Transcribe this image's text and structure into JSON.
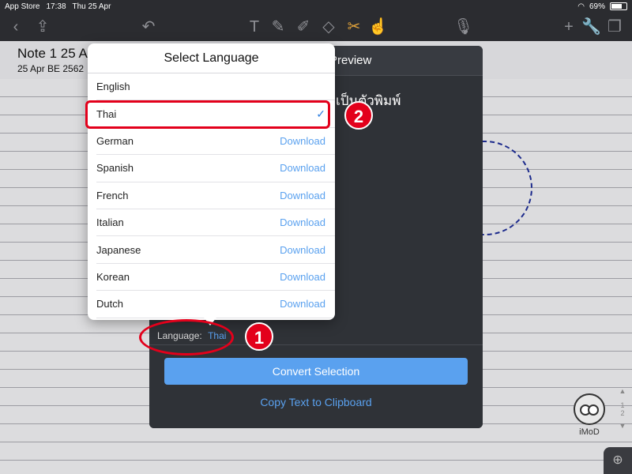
{
  "status_bar": {
    "back_app": "App Store",
    "time": "17:38",
    "date": "Thu 25 Apr",
    "battery": "69%"
  },
  "toolbar": {
    "left_icons": [
      "back-icon",
      "share-icon",
      "undo-icon"
    ],
    "tool_icons": [
      "text-tool-icon",
      "pen-tool-icon",
      "highlighter-tool-icon",
      "eraser-tool-icon",
      "lasso-tool-icon",
      "shape-tool-icon"
    ],
    "right_icons": [
      "microphone-icon",
      "add-icon",
      "wrench-icon",
      "pages-icon"
    ]
  },
  "note": {
    "title": "Note 1 25 A",
    "date": "25 Apr BE 2562"
  },
  "preview": {
    "title": "Preview",
    "recognized_text": "เป็นตัวพิมพ์",
    "language_label": "Language:",
    "language_value": "Thai",
    "convert_button": "Convert Selection",
    "copy_link": "Copy Text to Clipboard"
  },
  "popover": {
    "title": "Select Language",
    "download_label": "Download",
    "languages": [
      {
        "name": "English",
        "state": "installed"
      },
      {
        "name": "Thai",
        "state": "selected"
      },
      {
        "name": "German",
        "state": "download"
      },
      {
        "name": "Spanish",
        "state": "download"
      },
      {
        "name": "French",
        "state": "download"
      },
      {
        "name": "Italian",
        "state": "download"
      },
      {
        "name": "Japanese",
        "state": "download"
      },
      {
        "name": "Korean",
        "state": "download"
      },
      {
        "name": "Dutch",
        "state": "download"
      }
    ]
  },
  "annotations": {
    "badge_1": "1",
    "badge_2": "2"
  },
  "pager": {
    "current": "1",
    "total": "2"
  },
  "watermark": "iMoD",
  "colors": {
    "accent": "#5aa1ef",
    "highlight": "#e3001b",
    "toolbar_bg": "#2b2c30"
  }
}
